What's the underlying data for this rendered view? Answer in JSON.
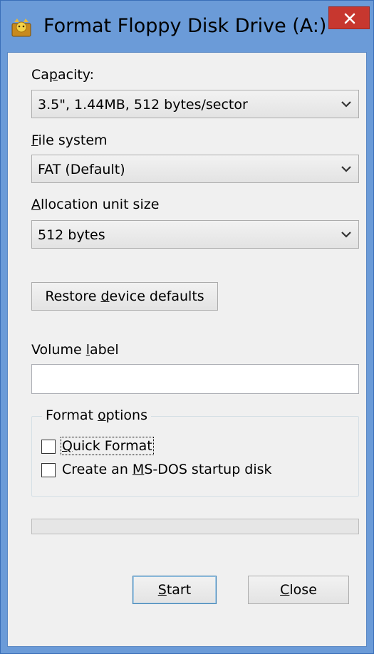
{
  "window": {
    "title": "Format Floppy Disk Drive (A:)"
  },
  "capacity": {
    "label_pre": "Ca",
    "label_key": "p",
    "label_post": "acity:",
    "value": "3.5\",  1.44MB, 512 bytes/sector"
  },
  "file_system": {
    "label_pre": "",
    "label_key": "F",
    "label_post": "ile system",
    "value": "FAT (Default)"
  },
  "allocation": {
    "label_pre": "",
    "label_key": "A",
    "label_post": "llocation unit size",
    "value": "512 bytes"
  },
  "restore_button": {
    "pre": "Restore ",
    "key": "d",
    "post": "evice defaults"
  },
  "volume_label": {
    "label_pre": "Volume ",
    "label_key": "l",
    "label_post": "abel",
    "value": ""
  },
  "format_options": {
    "legend_pre": "Format ",
    "legend_key": "o",
    "legend_post": "ptions",
    "quick_format": {
      "key": "Q",
      "post": "uick Format",
      "checked": false
    },
    "msdos": {
      "pre": "Create an ",
      "key": "M",
      "post": "S-DOS startup disk",
      "checked": false
    }
  },
  "progress": {
    "value": 0
  },
  "buttons": {
    "start": {
      "key": "S",
      "post": "tart"
    },
    "close": {
      "key": "C",
      "post": "lose"
    }
  },
  "colors": {
    "title_bar": "#6b9bd8",
    "close_button": "#c7372f",
    "dialog_bg": "#f0f0f0"
  },
  "icons": {
    "app": "floppy-format-app-icon",
    "close": "close-x-icon",
    "dropdown": "chevron-down-icon"
  }
}
